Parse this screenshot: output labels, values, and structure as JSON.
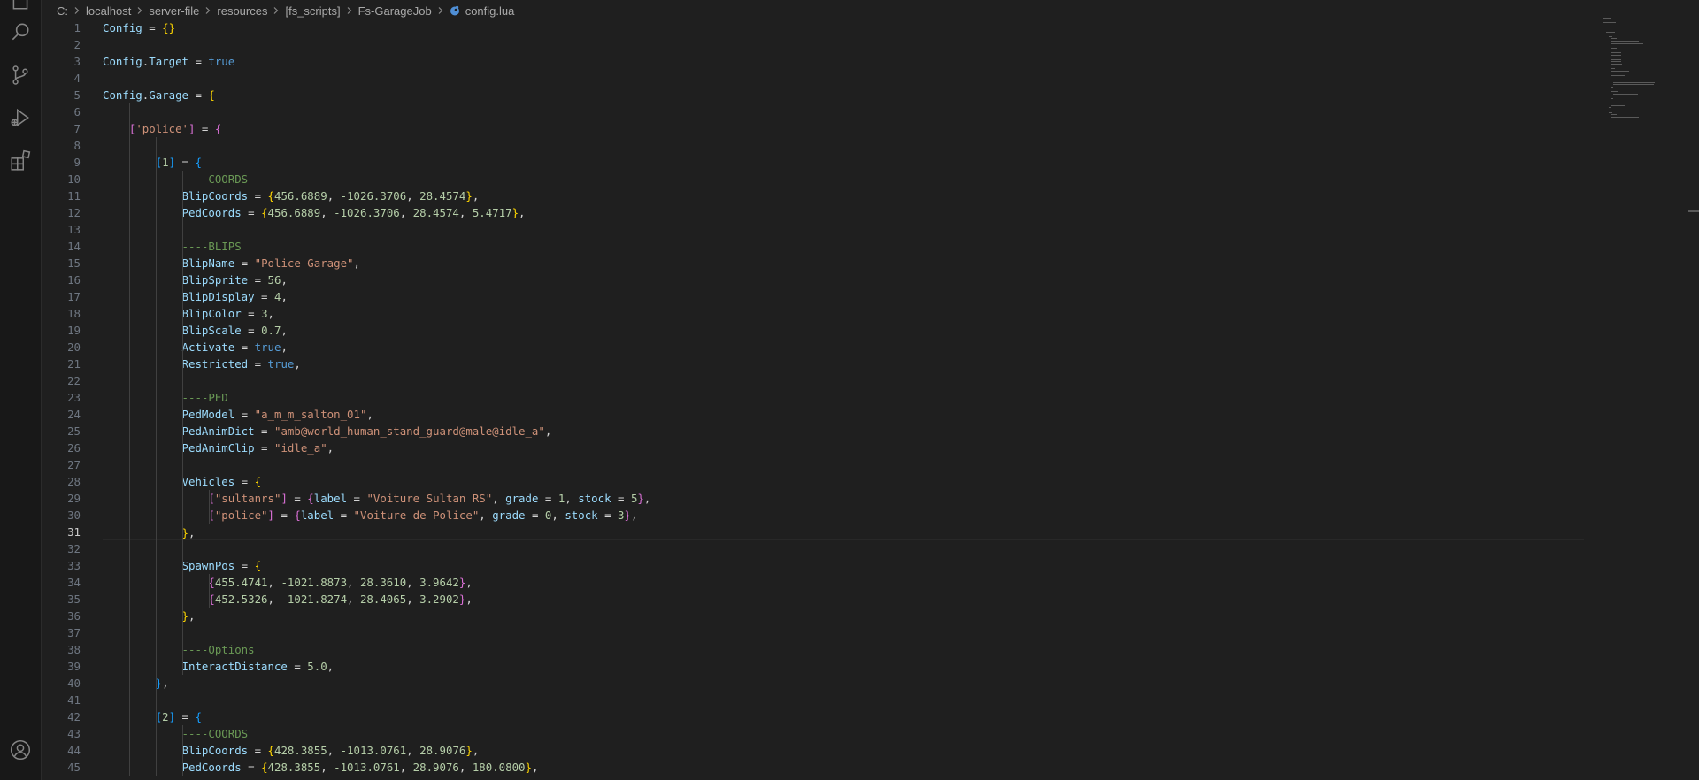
{
  "activity_bar": {
    "icons": [
      "files-icon",
      "search-icon",
      "source-control-icon",
      "run-debug-icon",
      "extensions-icon",
      "account-icon"
    ]
  },
  "breadcrumb": [
    "C:",
    "localhost",
    "server-file",
    "resources",
    "[fs_scripts]",
    "Fs-GarageJob",
    "config.lua"
  ],
  "editor": {
    "active_line": 31,
    "lines": [
      {
        "n": 1,
        "indent": 0,
        "tokens": [
          [
            "var",
            "Config"
          ],
          [
            "op",
            " = "
          ],
          [
            "b1",
            "{}"
          ]
        ]
      },
      {
        "n": 2,
        "indent": 0,
        "tokens": []
      },
      {
        "n": 3,
        "indent": 0,
        "tokens": [
          [
            "var",
            "Config"
          ],
          [
            "op",
            "."
          ],
          [
            "var",
            "Target"
          ],
          [
            "op",
            " = "
          ],
          [
            "kw",
            "true"
          ]
        ]
      },
      {
        "n": 4,
        "indent": 0,
        "tokens": []
      },
      {
        "n": 5,
        "indent": 0,
        "tokens": [
          [
            "var",
            "Config"
          ],
          [
            "op",
            "."
          ],
          [
            "var",
            "Garage"
          ],
          [
            "op",
            " = "
          ],
          [
            "b1",
            "{"
          ]
        ]
      },
      {
        "n": 6,
        "indent": 1,
        "tokens": []
      },
      {
        "n": 7,
        "indent": 1,
        "tokens": [
          [
            "op",
            "    "
          ],
          [
            "b2",
            "["
          ],
          [
            "str",
            "'police'"
          ],
          [
            "b2",
            "]"
          ],
          [
            "op",
            " = "
          ],
          [
            "b2",
            "{"
          ]
        ]
      },
      {
        "n": 8,
        "indent": 2,
        "tokens": []
      },
      {
        "n": 9,
        "indent": 2,
        "tokens": [
          [
            "op",
            "        "
          ],
          [
            "b3",
            "["
          ],
          [
            "num",
            "1"
          ],
          [
            "b3",
            "]"
          ],
          [
            "op",
            " = "
          ],
          [
            "b3",
            "{"
          ]
        ]
      },
      {
        "n": 10,
        "indent": 3,
        "tokens": [
          [
            "op",
            "            "
          ],
          [
            "cmt",
            "----COORDS"
          ]
        ]
      },
      {
        "n": 11,
        "indent": 3,
        "tokens": [
          [
            "op",
            "            "
          ],
          [
            "var",
            "BlipCoords"
          ],
          [
            "op",
            " = "
          ],
          [
            "b1",
            "{"
          ],
          [
            "num",
            "456.6889"
          ],
          [
            "op",
            ", "
          ],
          [
            "num",
            "-1026.3706"
          ],
          [
            "op",
            ", "
          ],
          [
            "num",
            "28.4574"
          ],
          [
            "b1",
            "}"
          ],
          [
            "op",
            ","
          ]
        ]
      },
      {
        "n": 12,
        "indent": 3,
        "tokens": [
          [
            "op",
            "            "
          ],
          [
            "var",
            "PedCoords"
          ],
          [
            "op",
            " = "
          ],
          [
            "b1",
            "{"
          ],
          [
            "num",
            "456.6889"
          ],
          [
            "op",
            ", "
          ],
          [
            "num",
            "-1026.3706"
          ],
          [
            "op",
            ", "
          ],
          [
            "num",
            "28.4574"
          ],
          [
            "op",
            ", "
          ],
          [
            "num",
            "5.4717"
          ],
          [
            "b1",
            "}"
          ],
          [
            "op",
            ","
          ]
        ]
      },
      {
        "n": 13,
        "indent": 3,
        "tokens": []
      },
      {
        "n": 14,
        "indent": 3,
        "tokens": [
          [
            "op",
            "            "
          ],
          [
            "cmt",
            "----BLIPS"
          ]
        ]
      },
      {
        "n": 15,
        "indent": 3,
        "tokens": [
          [
            "op",
            "            "
          ],
          [
            "var",
            "BlipName"
          ],
          [
            "op",
            " = "
          ],
          [
            "str",
            "\"Police Garage\""
          ],
          [
            "op",
            ","
          ]
        ]
      },
      {
        "n": 16,
        "indent": 3,
        "tokens": [
          [
            "op",
            "            "
          ],
          [
            "var",
            "BlipSprite"
          ],
          [
            "op",
            " = "
          ],
          [
            "num",
            "56"
          ],
          [
            "op",
            ","
          ]
        ]
      },
      {
        "n": 17,
        "indent": 3,
        "tokens": [
          [
            "op",
            "            "
          ],
          [
            "var",
            "BlipDisplay"
          ],
          [
            "op",
            " = "
          ],
          [
            "num",
            "4"
          ],
          [
            "op",
            ","
          ]
        ]
      },
      {
        "n": 18,
        "indent": 3,
        "tokens": [
          [
            "op",
            "            "
          ],
          [
            "var",
            "BlipColor"
          ],
          [
            "op",
            " = "
          ],
          [
            "num",
            "3"
          ],
          [
            "op",
            ","
          ]
        ]
      },
      {
        "n": 19,
        "indent": 3,
        "tokens": [
          [
            "op",
            "            "
          ],
          [
            "var",
            "BlipScale"
          ],
          [
            "op",
            " = "
          ],
          [
            "num",
            "0.7"
          ],
          [
            "op",
            ","
          ]
        ]
      },
      {
        "n": 20,
        "indent": 3,
        "tokens": [
          [
            "op",
            "            "
          ],
          [
            "var",
            "Activate"
          ],
          [
            "op",
            " = "
          ],
          [
            "kw",
            "true"
          ],
          [
            "op",
            ","
          ]
        ]
      },
      {
        "n": 21,
        "indent": 3,
        "tokens": [
          [
            "op",
            "            "
          ],
          [
            "var",
            "Restricted"
          ],
          [
            "op",
            " = "
          ],
          [
            "kw",
            "true"
          ],
          [
            "op",
            ","
          ]
        ]
      },
      {
        "n": 22,
        "indent": 3,
        "tokens": []
      },
      {
        "n": 23,
        "indent": 3,
        "tokens": [
          [
            "op",
            "            "
          ],
          [
            "cmt",
            "----PED"
          ]
        ]
      },
      {
        "n": 24,
        "indent": 3,
        "tokens": [
          [
            "op",
            "            "
          ],
          [
            "var",
            "PedModel"
          ],
          [
            "op",
            " = "
          ],
          [
            "str",
            "\"a_m_m_salton_01\""
          ],
          [
            "op",
            ","
          ]
        ]
      },
      {
        "n": 25,
        "indent": 3,
        "tokens": [
          [
            "op",
            "            "
          ],
          [
            "var",
            "PedAnimDict"
          ],
          [
            "op",
            " = "
          ],
          [
            "str",
            "\"amb@world_human_stand_guard@male@idle_a\""
          ],
          [
            "op",
            ","
          ]
        ]
      },
      {
        "n": 26,
        "indent": 3,
        "tokens": [
          [
            "op",
            "            "
          ],
          [
            "var",
            "PedAnimClip"
          ],
          [
            "op",
            " = "
          ],
          [
            "str",
            "\"idle_a\""
          ],
          [
            "op",
            ","
          ]
        ]
      },
      {
        "n": 27,
        "indent": 3,
        "tokens": []
      },
      {
        "n": 28,
        "indent": 3,
        "tokens": [
          [
            "op",
            "            "
          ],
          [
            "var",
            "Vehicles"
          ],
          [
            "op",
            " = "
          ],
          [
            "b1",
            "{"
          ]
        ]
      },
      {
        "n": 29,
        "indent": 4,
        "tokens": [
          [
            "op",
            "                "
          ],
          [
            "b2",
            "["
          ],
          [
            "str",
            "\"sultanrs\""
          ],
          [
            "b2",
            "]"
          ],
          [
            "op",
            " = "
          ],
          [
            "b2",
            "{"
          ],
          [
            "var",
            "label"
          ],
          [
            "op",
            " = "
          ],
          [
            "str",
            "\"Voiture Sultan RS\""
          ],
          [
            "op",
            ", "
          ],
          [
            "var",
            "grade"
          ],
          [
            "op",
            " = "
          ],
          [
            "num",
            "1"
          ],
          [
            "op",
            ", "
          ],
          [
            "var",
            "stock"
          ],
          [
            "op",
            " = "
          ],
          [
            "num",
            "5"
          ],
          [
            "b2",
            "}"
          ],
          [
            "op",
            ","
          ]
        ]
      },
      {
        "n": 30,
        "indent": 4,
        "tokens": [
          [
            "op",
            "                "
          ],
          [
            "b2",
            "["
          ],
          [
            "str",
            "\"police\""
          ],
          [
            "b2",
            "]"
          ],
          [
            "op",
            " = "
          ],
          [
            "b2",
            "{"
          ],
          [
            "var",
            "label"
          ],
          [
            "op",
            " = "
          ],
          [
            "str",
            "\"Voiture de Police\""
          ],
          [
            "op",
            ", "
          ],
          [
            "var",
            "grade"
          ],
          [
            "op",
            " = "
          ],
          [
            "num",
            "0"
          ],
          [
            "op",
            ", "
          ],
          [
            "var",
            "stock"
          ],
          [
            "op",
            " = "
          ],
          [
            "num",
            "3"
          ],
          [
            "b2",
            "}"
          ],
          [
            "op",
            ","
          ]
        ]
      },
      {
        "n": 31,
        "indent": 3,
        "tokens": [
          [
            "op",
            "            "
          ],
          [
            "b1",
            "}"
          ],
          [
            "op",
            ","
          ]
        ]
      },
      {
        "n": 32,
        "indent": 3,
        "tokens": []
      },
      {
        "n": 33,
        "indent": 3,
        "tokens": [
          [
            "op",
            "            "
          ],
          [
            "var",
            "SpawnPos"
          ],
          [
            "op",
            " = "
          ],
          [
            "b1",
            "{"
          ]
        ]
      },
      {
        "n": 34,
        "indent": 4,
        "tokens": [
          [
            "op",
            "                "
          ],
          [
            "b2",
            "{"
          ],
          [
            "num",
            "455.4741"
          ],
          [
            "op",
            ", "
          ],
          [
            "num",
            "-1021.8873"
          ],
          [
            "op",
            ", "
          ],
          [
            "num",
            "28.3610"
          ],
          [
            "op",
            ", "
          ],
          [
            "num",
            "3.9642"
          ],
          [
            "b2",
            "}"
          ],
          [
            "op",
            ","
          ]
        ]
      },
      {
        "n": 35,
        "indent": 4,
        "tokens": [
          [
            "op",
            "                "
          ],
          [
            "b2",
            "{"
          ],
          [
            "num",
            "452.5326"
          ],
          [
            "op",
            ", "
          ],
          [
            "num",
            "-1021.8274"
          ],
          [
            "op",
            ", "
          ],
          [
            "num",
            "28.4065"
          ],
          [
            "op",
            ", "
          ],
          [
            "num",
            "3.2902"
          ],
          [
            "b2",
            "}"
          ],
          [
            "op",
            ","
          ]
        ]
      },
      {
        "n": 36,
        "indent": 3,
        "tokens": [
          [
            "op",
            "            "
          ],
          [
            "b1",
            "}"
          ],
          [
            "op",
            ","
          ]
        ]
      },
      {
        "n": 37,
        "indent": 3,
        "tokens": []
      },
      {
        "n": 38,
        "indent": 3,
        "tokens": [
          [
            "op",
            "            "
          ],
          [
            "cmt",
            "----Options"
          ]
        ]
      },
      {
        "n": 39,
        "indent": 3,
        "tokens": [
          [
            "op",
            "            "
          ],
          [
            "var",
            "InteractDistance"
          ],
          [
            "op",
            " = "
          ],
          [
            "num",
            "5.0"
          ],
          [
            "op",
            ","
          ]
        ]
      },
      {
        "n": 40,
        "indent": 2,
        "tokens": [
          [
            "op",
            "        "
          ],
          [
            "b3",
            "}"
          ],
          [
            "op",
            ","
          ]
        ]
      },
      {
        "n": 41,
        "indent": 2,
        "tokens": []
      },
      {
        "n": 42,
        "indent": 2,
        "tokens": [
          [
            "op",
            "        "
          ],
          [
            "b3",
            "["
          ],
          [
            "num",
            "2"
          ],
          [
            "b3",
            "]"
          ],
          [
            "op",
            " = "
          ],
          [
            "b3",
            "{"
          ]
        ]
      },
      {
        "n": 43,
        "indent": 3,
        "tokens": [
          [
            "op",
            "            "
          ],
          [
            "cmt",
            "----COORDS"
          ]
        ]
      },
      {
        "n": 44,
        "indent": 3,
        "tokens": [
          [
            "op",
            "            "
          ],
          [
            "var",
            "BlipCoords"
          ],
          [
            "op",
            " = "
          ],
          [
            "b1",
            "{"
          ],
          [
            "num",
            "428.3855"
          ],
          [
            "op",
            ", "
          ],
          [
            "num",
            "-1013.0761"
          ],
          [
            "op",
            ", "
          ],
          [
            "num",
            "28.9076"
          ],
          [
            "b1",
            "}"
          ],
          [
            "op",
            ","
          ]
        ]
      },
      {
        "n": 45,
        "indent": 3,
        "tokens": [
          [
            "op",
            "            "
          ],
          [
            "var",
            "PedCoords"
          ],
          [
            "op",
            " = "
          ],
          [
            "b1",
            "{"
          ],
          [
            "num",
            "428.3855"
          ],
          [
            "op",
            ", "
          ],
          [
            "num",
            "-1013.0761"
          ],
          [
            "op",
            ", "
          ],
          [
            "num",
            "28.9076"
          ],
          [
            "op",
            ", "
          ],
          [
            "num",
            "180.0800"
          ],
          [
            "b1",
            "}"
          ],
          [
            "op",
            ","
          ]
        ]
      }
    ]
  }
}
